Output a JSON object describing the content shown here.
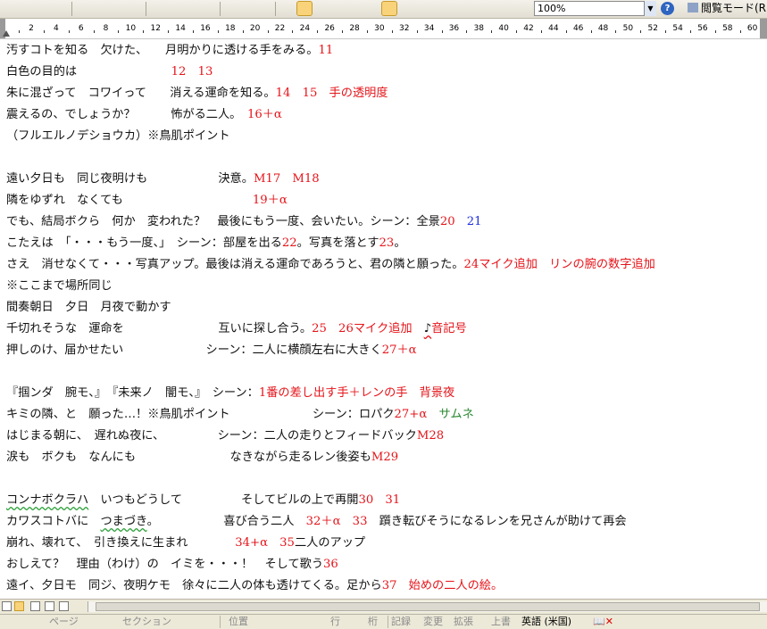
{
  "toolbar": {
    "zoom_value": "100%",
    "reading_mode_label": "閲覧モード(R)"
  },
  "ruler": {
    "numbers": [
      "2",
      "4",
      "6",
      "8",
      "10",
      "12",
      "14",
      "16",
      "18",
      "20",
      "22",
      "24",
      "26",
      "28",
      "30",
      "32",
      "34",
      "36",
      "38",
      "40",
      "42",
      "44",
      "46",
      "48",
      "50",
      "52",
      "54",
      "56",
      "58",
      "60"
    ]
  },
  "document": {
    "lines": [
      [
        {
          "t": "汚すコトを知る　欠けた、　　月明かりに透ける手をみる。"
        },
        {
          "t": "11",
          "c": "red"
        }
      ],
      [
        {
          "t": "白色の目的は　　　　　　　　"
        },
        {
          "t": "12　13",
          "c": "red"
        }
      ],
      [
        {
          "t": "朱に混ざって　コワイって　　消える運命を知る。"
        },
        {
          "t": "14　15　手の透明度",
          "c": "red"
        }
      ],
      [
        {
          "t": "震えるの、でしょうか？　　　怖がる二人。　"
        },
        {
          "t": "16＋α",
          "c": "red"
        }
      ],
      [
        {
          "t": "（フルエルノデショウカ）※鳥肌ポイント"
        }
      ],
      [],
      [
        {
          "t": "遠い夕日も　同じ夜明けも　　　　　　決意。"
        },
        {
          "t": "M17　M18",
          "c": "red"
        }
      ],
      [
        {
          "t": "隣をゆずれ　なくても　　　　　　　　　　　"
        },
        {
          "t": "19＋α",
          "c": "red"
        }
      ],
      [
        {
          "t": "でも、結局ボクら　何か　変われた？　最後にもう一度、会いたい。シーン：全景"
        },
        {
          "t": "20",
          "c": "red"
        },
        {
          "t": "　"
        },
        {
          "t": "21",
          "c": "blue"
        }
      ],
      [
        {
          "t": "こたえは　「・・・もう一度、」　シーン：部屋を出る"
        },
        {
          "t": "22",
          "c": "red"
        },
        {
          "t": "。写真を落とす"
        },
        {
          "t": "23",
          "c": "red"
        },
        {
          "t": "。"
        }
      ],
      [
        {
          "t": "さえ　消せなくて・・・写真アップ。最後は消える運命であろうと、君の隣と願った。"
        },
        {
          "t": "24マイク追加　リンの腕の数字追加",
          "c": "red"
        }
      ],
      [
        {
          "t": "※ここまで場所同じ"
        }
      ],
      [
        {
          "t": "間奏朝日　夕日　月夜で動かす"
        }
      ],
      [
        {
          "t": "千切れそうな　運命を　　　　　　　　互いに探し合う。"
        },
        {
          "t": "25　26マイク追加　",
          "c": "red"
        },
        {
          "t": "♪",
          "c": "wavyr"
        },
        {
          "t": "音記号",
          "c": "red"
        }
      ],
      [
        {
          "t": "押しのけ、届かせたい　　　　　　　シーン：二人に横顔左右に大きく"
        },
        {
          "t": "27＋α",
          "c": "red"
        }
      ],
      [],
      [
        {
          "t": "『掴ンダ　腕モ、』　『未来ノ　闇モ、』　シーン："
        },
        {
          "t": "1番の差し出す手＋レンの手　背景夜",
          "c": "red"
        }
      ],
      [
        {
          "t": "キミの隣、と　願った…！※鳥肌ポイント　　　　　　　シーン：ロパク"
        },
        {
          "t": "27+α",
          "c": "red"
        },
        {
          "t": "　"
        },
        {
          "t": "サムネ",
          "c": "green"
        }
      ],
      [
        {
          "t": "はじまる朝に、　遅れぬ夜に、　　　　　シーン：二人の走りとフィードバック"
        },
        {
          "t": "M28",
          "c": "red"
        }
      ],
      [
        {
          "t": "涙も　ボクも　なんにも　　　　　　　　なきながら走るレン後姿も"
        },
        {
          "t": "M29",
          "c": "red"
        }
      ],
      [],
      [
        {
          "t": "コンナボクラハ",
          "c": "wavy"
        },
        {
          "t": "　いつもどうして　　　　　そしてビルの上で再開"
        },
        {
          "t": "30　31",
          "c": "red"
        }
      ],
      [
        {
          "t": "カワスコトバに　"
        },
        {
          "t": "つまづき",
          "c": "wavy"
        },
        {
          "t": "。　　　　　　喜び合う二人　"
        },
        {
          "t": "32＋α　33",
          "c": "red"
        },
        {
          "t": "　躓き転びそうになるレンを兄さんが助けて再会"
        }
      ],
      [
        {
          "t": "崩れ、壊れて、　引き換えに生まれ　　　　"
        },
        {
          "t": "34+α　35",
          "c": "red"
        },
        {
          "t": "二人のアップ"
        }
      ],
      [
        {
          "t": "おしえて？　理由（わけ）の　イミを・・・！　そして歌う"
        },
        {
          "t": "36",
          "c": "red"
        }
      ],
      [
        {
          "t": "遠イ、夕日モ　同ジ、夜明ケモ　徐々に二人の体も透けてくる。足から"
        },
        {
          "t": "37　始めの二人の絵。",
          "c": "red"
        }
      ]
    ]
  },
  "status": {
    "page": "ページ",
    "section": "セクション",
    "position": "位置",
    "line": "行",
    "column": "桁",
    "rec": "記録",
    "trk": "変更",
    "ext": "拡張",
    "ovr": "上書",
    "language": "英語 (米国)"
  }
}
